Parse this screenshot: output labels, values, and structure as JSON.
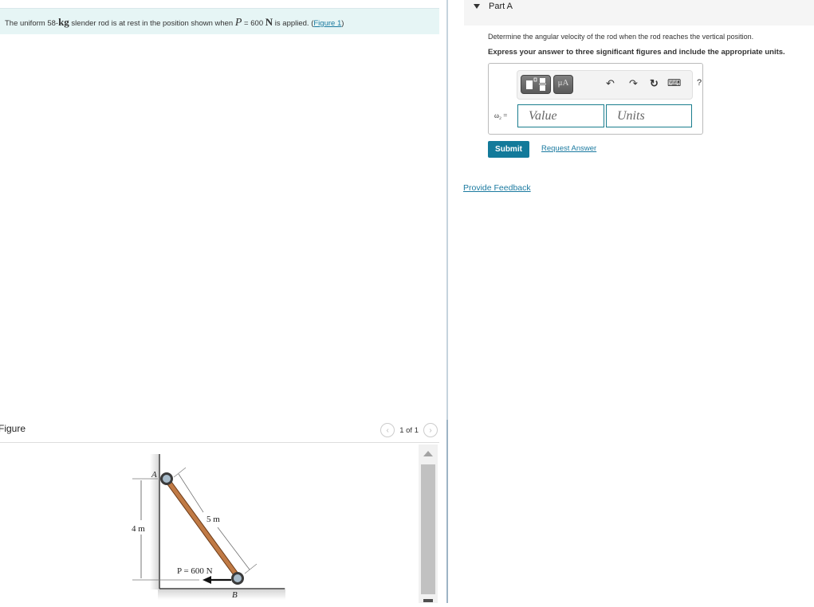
{
  "problem": {
    "text_1": "The uniform 58-",
    "mass_unit": "kg",
    "text_2": " slender rod is at rest in the position shown when ",
    "force_symbol": "P",
    "text_3": " = 600 ",
    "force_unit": "N",
    "text_4": " is applied. (",
    "figure_link": "Figure 1",
    "text_5": ")"
  },
  "figure": {
    "title": "Figure",
    "pager": {
      "text": "1 of 1",
      "prev_icon": "‹",
      "next_icon": "›"
    },
    "labels": {
      "A": "A",
      "B": "B",
      "height": "4 m",
      "length": "5 m",
      "force": "P = 600 N"
    }
  },
  "part": {
    "title": "Part A",
    "question": "Determine the angular velocity of the rod when the rod reaches the vertical position.",
    "instruction": "Express your answer to three significant figures and include the appropriate units.",
    "toolbar": {
      "templates_icon": "templates-icon",
      "units_label": "μA",
      "undo_icon": "↶",
      "redo_icon": "↷",
      "reset_icon": "↻",
      "keyboard_icon": "⌨",
      "help_icon": "?"
    },
    "equation_label": "ω₂ =",
    "value_placeholder": "Value",
    "units_placeholder": "Units",
    "submit_label": "Submit",
    "request_answer_label": "Request Answer"
  },
  "feedback_label": "Provide Feedback",
  "colors": {
    "accent": "#137a9a",
    "link": "#1b7aa0",
    "problem_bg": "#e6f5f5"
  }
}
